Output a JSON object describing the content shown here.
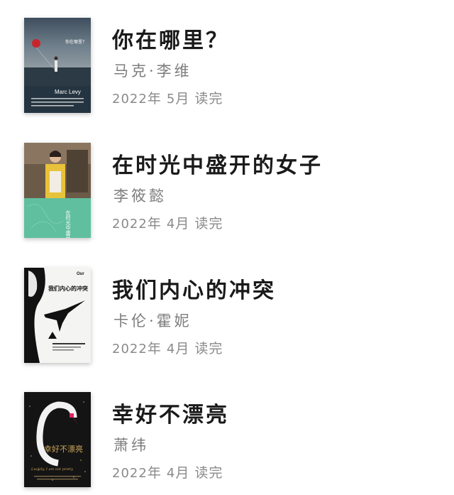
{
  "books": [
    {
      "title": "你在哪里？",
      "author": "马克·李维",
      "date_year": "2022",
      "date_month": "5",
      "cover_title": "你在哪里?",
      "cover_author_en": "Marc Levy"
    },
    {
      "title": "在时光中盛开的女子",
      "author": "李筱懿",
      "date_year": "2022",
      "date_month": "4",
      "cover_title": "在时光中盛开的女子"
    },
    {
      "title": "我们内心的冲突",
      "author": "卡伦·霍妮",
      "date_year": "2022",
      "date_month": "4",
      "cover_title": "我们内心的冲突",
      "cover_brand": "Our"
    },
    {
      "title": "幸好不漂亮",
      "author": "萧纬",
      "date_year": "2022",
      "date_month": "4",
      "cover_title": "幸好不漂亮",
      "cover_script": "Luckily, I am not pretty"
    }
  ],
  "labels": {
    "year_unit": "年",
    "month_unit": "月",
    "read_done": "读完"
  },
  "colors": {
    "title": "#1a1a1a",
    "author": "#7d7d7d",
    "date": "#8a8a8a"
  }
}
